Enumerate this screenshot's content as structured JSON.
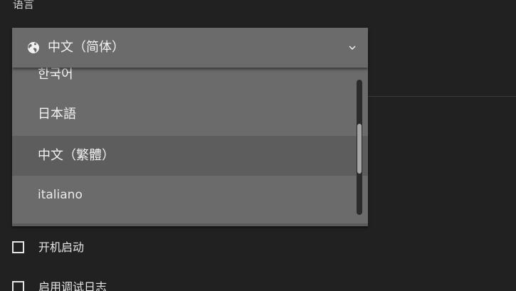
{
  "language_section": {
    "label": "语言",
    "selected": "中文（简体）",
    "icon": "globe-icon",
    "options": [
      "한국어",
      "日本語",
      "中文（繁體）",
      "italiano"
    ],
    "highlighted_option": "中文（繁體）",
    "scroll_position": 0.4
  },
  "settings": {
    "autostart_label": "开机启动",
    "autostart_checked": false,
    "debug_log_label": "启用调试日志",
    "debug_log_checked": false
  },
  "colors": {
    "background": "#212121",
    "select_surface": "#6b6b6b",
    "highlight": "#5d5d5d",
    "text": "#f2f2f2"
  }
}
